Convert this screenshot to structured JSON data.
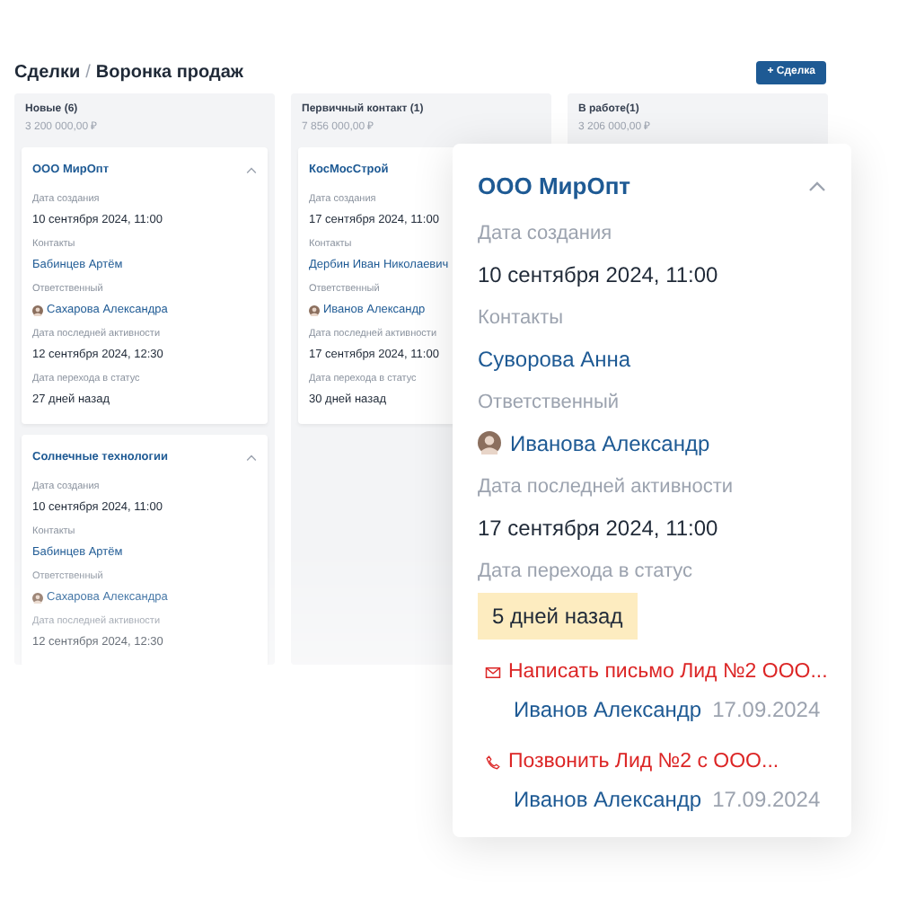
{
  "breadcrumb": {
    "parent": "Сделки",
    "separator": "/",
    "current": "Воронка продаж"
  },
  "add_button": "+ Сделка",
  "columns": [
    {
      "title": "Новые (6)",
      "sum": "3 200 000,00 ₽",
      "cards": [
        {
          "title": "ООО МирОпт",
          "expanded": true,
          "fields": [
            {
              "label": "Дата создания",
              "value": "10 сентября 2024, 11:00",
              "kind": "text"
            },
            {
              "label": "Контакты",
              "value": "Бабинцев Артём",
              "kind": "link"
            },
            {
              "label": "Ответственный",
              "value": "Сахарова Александра",
              "kind": "person"
            },
            {
              "label": "Дата последней активности",
              "value": "12 сентября 2024, 12:30",
              "kind": "text"
            },
            {
              "label": "Дата перехода в статус",
              "value": "27 дней назад",
              "kind": "text"
            }
          ]
        },
        {
          "title": "Солнечные технологии",
          "expanded": true,
          "fields": [
            {
              "label": "Дата создания",
              "value": "10 сентября 2024, 11:00",
              "kind": "text"
            },
            {
              "label": "Контакты",
              "value": "Бабинцев Артём",
              "kind": "link"
            },
            {
              "label": "Ответственный",
              "value": "Сахарова Александра",
              "kind": "person"
            },
            {
              "label": "Дата последней активности",
              "value": "12 сентября 2024, 12:30",
              "kind": "text"
            }
          ]
        }
      ]
    },
    {
      "title": "Первичный контакт (1)",
      "sum": "7 856 000,00 ₽",
      "cards": [
        {
          "title": "КосМосСтрой",
          "fields": [
            {
              "label": "Дата создания",
              "value": "17 сентября 2024, 11:00",
              "kind": "text"
            },
            {
              "label": "Контакты",
              "value": "Дербин Иван Николаевич",
              "kind": "link"
            },
            {
              "label": "Ответственный",
              "value": "Иванов Александр",
              "kind": "person"
            },
            {
              "label": "Дата последней активности",
              "value": "17 сентября 2024, 11:00",
              "kind": "text"
            },
            {
              "label": "Дата перехода в статус",
              "value": "30 дней назад",
              "kind": "text"
            }
          ]
        }
      ]
    },
    {
      "title": "В работе(1)",
      "sum": "3 206 000,00 ₽"
    }
  ],
  "popup": {
    "title": "ООО МирОпт",
    "expanded": true,
    "fields": [
      {
        "label": "Дата создания",
        "value": "10 сентября 2024, 11:00",
        "kind": "text"
      },
      {
        "label": "Контакты",
        "value": "Суворова Анна",
        "kind": "link"
      },
      {
        "label": "Ответственный",
        "value": "Иванова Александр",
        "kind": "person"
      },
      {
        "label": "Дата последней активности",
        "value": "17 сентября 2024, 11:00",
        "kind": "text"
      },
      {
        "label": "Дата перехода в статус",
        "value": "5 дней назад",
        "kind": "badge"
      }
    ],
    "tasks": [
      {
        "kind": "mail",
        "title": "Написать письмо Лид №2 ООО...",
        "person": "Иванов Александр",
        "date": "17.09.2024"
      },
      {
        "kind": "phone",
        "title": "Позвонить Лид №2 с ООО...",
        "person": "Иванов Александр",
        "date": "17.09.2024"
      }
    ]
  }
}
